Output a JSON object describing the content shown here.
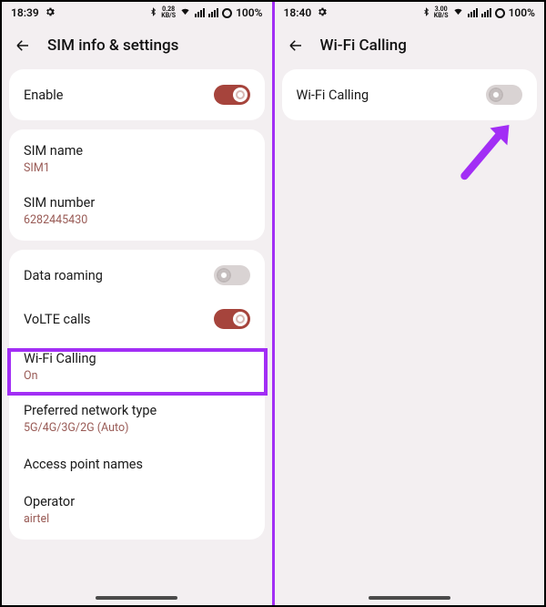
{
  "left": {
    "status": {
      "time": "18:39",
      "speed_top": "0.28",
      "speed_unit": "KB/S",
      "battery": "100%"
    },
    "title": "SIM info & settings",
    "enable": {
      "label": "Enable"
    },
    "sim_name": {
      "label": "SIM name",
      "value": "SIM1"
    },
    "sim_number": {
      "label": "SIM number",
      "value": "6282445430"
    },
    "data_roaming": {
      "label": "Data roaming"
    },
    "volte": {
      "label": "VoLTE calls"
    },
    "wifi_calling": {
      "label": "Wi-Fi Calling",
      "value": "On"
    },
    "pref_net": {
      "label": "Preferred network type",
      "value": "5G/4G/3G/2G (Auto)"
    },
    "apn": {
      "label": "Access point names"
    },
    "operator": {
      "label": "Operator",
      "value": "airtel"
    }
  },
  "right": {
    "status": {
      "time": "18:40",
      "speed_top": "3.00",
      "speed_unit": "KB/S",
      "battery": "100%"
    },
    "title": "Wi-Fi Calling",
    "wifi_calling": {
      "label": "Wi-Fi Calling"
    }
  }
}
